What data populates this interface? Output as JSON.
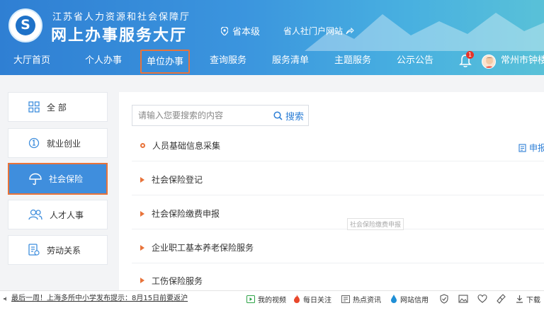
{
  "header": {
    "org_name": "江苏省人力资源和社会保障厅",
    "site_title": "网上办事服务大厅",
    "region": "省本级",
    "portal_link": "省人社门户网站",
    "notification_count": "1",
    "user_name": "常州市钟楼"
  },
  "nav": {
    "items": [
      {
        "label": "大厅首页"
      },
      {
        "label": "个人办事"
      },
      {
        "label": "单位办事"
      },
      {
        "label": "查询服务"
      },
      {
        "label": "服务清单"
      },
      {
        "label": "主题服务"
      },
      {
        "label": "公示公告"
      }
    ],
    "active_index": 2
  },
  "sidebar": {
    "items": [
      {
        "label": "全 部",
        "icon": "grid-icon"
      },
      {
        "label": "就业创业",
        "icon": "briefcase-icon"
      },
      {
        "label": "社会保险",
        "icon": "umbrella-icon"
      },
      {
        "label": "人才人事",
        "icon": "users-icon"
      },
      {
        "label": "劳动关系",
        "icon": "document-icon"
      }
    ],
    "active_index": 2
  },
  "search": {
    "placeholder": "请输入您要搜索的内容",
    "button_label": "搜索"
  },
  "apply_label": "申报",
  "services": [
    {
      "label": "人员基础信息采集"
    },
    {
      "label": "社会保险登记"
    },
    {
      "label": "社会保险缴费申报"
    },
    {
      "label": "企业职工基本养老保险服务"
    },
    {
      "label": "工伤保险服务"
    }
  ],
  "tooltip": "社会保险缴费申报",
  "bottom_bar": {
    "news": "最后一周！上海多所中小学发布提示：8月15日前要返沪",
    "tools": [
      {
        "label": "我的视频"
      },
      {
        "label": "每日关注"
      },
      {
        "label": "热点资讯"
      },
      {
        "label": "网站信用"
      }
    ],
    "download_label": "下载"
  },
  "colors": {
    "accent": "#2e7fd6",
    "highlight_border": "#e8733a",
    "active_sidebar": "#3f8edd"
  }
}
